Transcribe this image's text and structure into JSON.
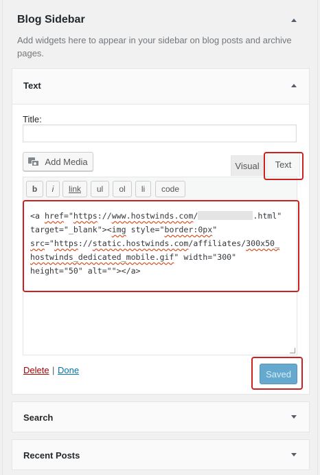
{
  "panel": {
    "title": "Blog Sidebar",
    "description": "Add widgets here to appear in your sidebar on blog posts and archive pages."
  },
  "text_widget": {
    "title": "Text",
    "title_label": "Title:",
    "title_value": "",
    "add_media_label": "Add Media",
    "tabs": {
      "visual": "Visual",
      "text": "Text",
      "active": "Text"
    },
    "quicktags": [
      "b",
      "i",
      "link",
      "ul",
      "ol",
      "li",
      "code"
    ],
    "code": {
      "l1a": "<a ",
      "l1b": "href",
      "l1c": "=\"",
      "l1d": "https",
      "l1e": "://",
      "l1f": "www.hostwinds.com",
      "l1g": "/",
      "l1h": ".html\"",
      "l2a": "target=\"_blank\"><",
      "l2b": "img",
      "l2c": " style=\"",
      "l2d": "border:0px",
      "l2e": "\"",
      "l3a": "src",
      "l3b": "=\"",
      "l3c": "https",
      "l3d": "://",
      "l3e": "static.hostwinds.com",
      "l3f": "/affiliates/",
      "l3g": "300x50_",
      "l4a": "hostwinds_dedicated_mobile.gif",
      "l4b": "\" width=\"300\"",
      "l5": "height=\"50\" alt=\"\"></a>"
    },
    "delete_label": "Delete",
    "separator": "|",
    "done_label": "Done",
    "save_label": "Saved"
  },
  "widgets": [
    {
      "title": "Search"
    },
    {
      "title": "Recent Posts"
    }
  ],
  "colors": {
    "highlight": "#cc1f1f",
    "link": "#0073aa",
    "delete": "#a00",
    "saved_button": "#66a9cf"
  }
}
